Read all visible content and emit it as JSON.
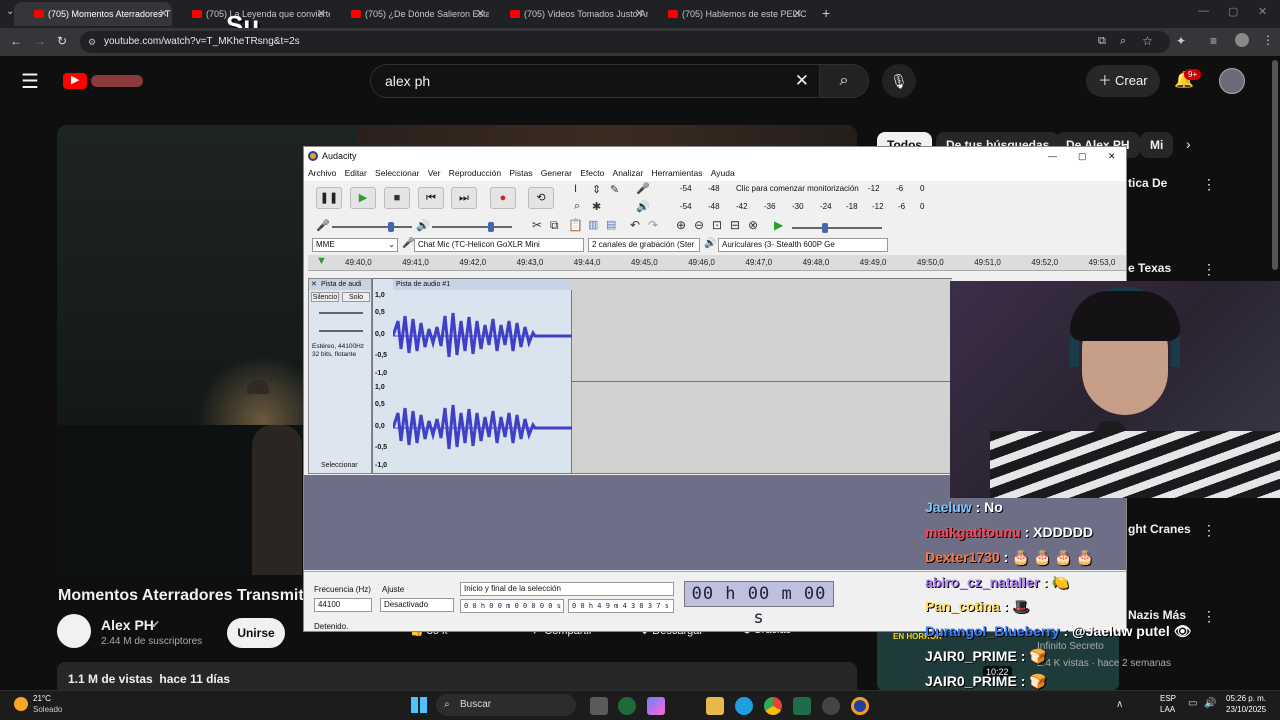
{
  "browser": {
    "tabs": [
      {
        "label": "(705) Momentos Aterradores T",
        "active": true
      },
      {
        "label": "(705) La Leyenda que convierte a",
        "active": false
      },
      {
        "label": "(705) ¿De Dónde Salieron Esta",
        "active": false
      },
      {
        "label": "(705) Videos Tomados Justo An",
        "active": false
      },
      {
        "label": "(705) Hablemos de este PELICU",
        "active": false
      }
    ],
    "url": "youtube.com/watch?v=T_MKheTRsng&t=2s",
    "overlay_text": "Su"
  },
  "youtube": {
    "search_value": "alex ph",
    "create_label": "Crear",
    "notif_badge": "9+",
    "chips": [
      "Todos",
      "De tus búsquedas",
      "De Alex PH",
      "Mi"
    ],
    "video_title": "Momentos Aterradores Transmiti",
    "channel_name": "Alex PH",
    "subscribers": "2.44 M de suscriptores",
    "join_label": "Unirse",
    "actions": {
      "likes": "35 k",
      "share": "Compartir",
      "download": "Descargar",
      "thanks": "Gracias"
    },
    "views": "1.1 M de vistas  hace 11 días",
    "side_titles": [
      "tica De",
      "e Texas",
      "ght Cranes",
      "Nazis Más"
    ],
    "side_meta": {
      "channel": "Infinito Secreto",
      "views": "2.4 K vistas · hace 2 semanas",
      "duration": "10:22",
      "badge": "EN HORROR"
    }
  },
  "audacity": {
    "title": "Audacity",
    "menus": [
      "Archivo",
      "Editar",
      "Seleccionar",
      "Ver",
      "Reproducción",
      "Pistas",
      "Generar",
      "Efecto",
      "Analizar",
      "Herramientas",
      "Ayuda"
    ],
    "meter_hint": "Clic para comenzar monitorización",
    "meter_ticks": [
      "-54",
      "-48",
      "-42",
      "-36",
      "-30",
      "-24",
      "-18",
      "-12",
      "-6",
      "0"
    ],
    "host": "MME",
    "input_device": "Chat Mic (TC-Helicon GoXLR Mini",
    "channels": "2 canales de grabación (Ster",
    "output_device": "Auriculares (3- Stealth 600P Ge",
    "ruler": [
      "49:40,0",
      "49:41,0",
      "49:42,0",
      "49:43,0",
      "49:44,0",
      "49:45,0",
      "49:46,0",
      "49:47,0",
      "49:48,0",
      "49:49,0",
      "49:50,0",
      "49:51,0",
      "49:52,0",
      "49:53,0"
    ],
    "track": {
      "name": "Pista de audi",
      "clip_name": "Pista de audio #1",
      "mute": "Silencio",
      "solo": "Solo",
      "info": "Estéreo, 44100Hz\n32 bits, flotante",
      "select": "Seleccionar",
      "scale": [
        "1,0",
        "0,5",
        "0,0",
        "-0,5",
        "-1,0"
      ]
    },
    "bottom": {
      "rate_label": "Frecuencia (Hz)",
      "rate_value": "44100",
      "snap_label": "Ajuste",
      "snap_value": "Desactivado",
      "selection_label": "Inicio y final de la selección",
      "sel_start": "0 0 h 0 0 m 0 0 0 0 0 s",
      "sel_end": "0 0 h 4 9 m 4 3 8 3 7 s",
      "big_time": "00 h 00 m 00 s",
      "status": "Detenido."
    }
  },
  "chat": [
    {
      "user": "Jaeluw",
      "msg": ": No",
      "color": "#7ec8ff"
    },
    {
      "user": "maikgatitounu",
      "msg": ": XDDDDD",
      "color": "#ff4455"
    },
    {
      "user": "Dexter1730",
      "msg": ": 🎂 🎂 🎂 🎂",
      "color": "#ff7744"
    },
    {
      "user": "abiro_cz_nataller",
      "msg": ": 🍋",
      "color": "#b085f5"
    },
    {
      "user": "Pan_cotina",
      "msg": ": 🎩",
      "color": "#ffe066"
    },
    {
      "user": "Durangol_Blueberry",
      "msg": ": @Jaeluw putel 👁",
      "color": "#3c7dff"
    },
    {
      "user": "JAIR0_PRIME",
      "msg": ": 🍞",
      "color": "#ffffff"
    },
    {
      "user": "JAIR0_PRIME",
      "msg": ": 🍞",
      "color": "#ffffff"
    }
  ],
  "taskbar": {
    "temp": "21°C",
    "weather": "Soleado",
    "search_label": "Buscar",
    "lang": "ESP",
    "lang2": "LAA",
    "time": "05:26 p. m.",
    "date": "23/10/2025"
  }
}
